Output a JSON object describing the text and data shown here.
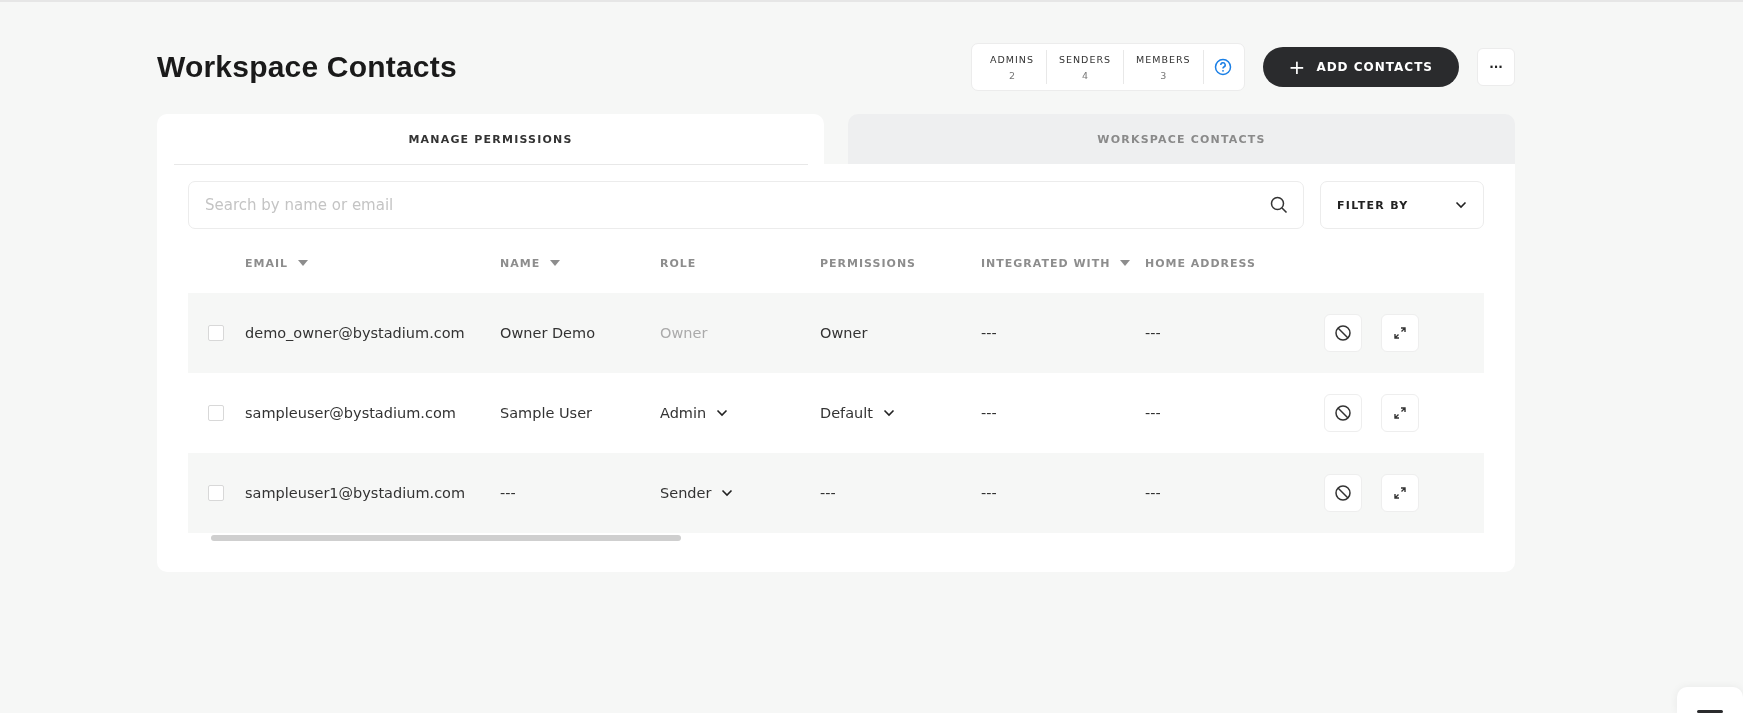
{
  "page_title": "Workspace Contacts",
  "stats": [
    {
      "label": "ADMINS",
      "count": "2"
    },
    {
      "label": "SENDERS",
      "count": "4"
    },
    {
      "label": "MEMBERS",
      "count": "3"
    }
  ],
  "add_button": {
    "icon": "+",
    "label": "ADD CONTACTS"
  },
  "more_button": "···",
  "tabs": [
    {
      "label": "MANAGE PERMISSIONS",
      "selected": true
    },
    {
      "label": "WORKSPACE CONTACTS",
      "selected": false
    }
  ],
  "search": {
    "placeholder": "Search by name or email"
  },
  "filter": {
    "label": "FILTER BY"
  },
  "table": {
    "columns": [
      {
        "label": "EMAIL",
        "sortable": true
      },
      {
        "label": "NAME",
        "sortable": true
      },
      {
        "label": "ROLE",
        "sortable": false
      },
      {
        "label": "PERMISSIONS",
        "sortable": false
      },
      {
        "label": "INTEGRATED WITH",
        "sortable": true
      },
      {
        "label": "HOME ADDRESS",
        "sortable": false
      }
    ],
    "rows": [
      {
        "checked": false,
        "email": "demo_owner@bystadium.com",
        "name": "Owner Demo",
        "role": {
          "text": "Owner",
          "editable": false
        },
        "permissions": {
          "text": "Owner",
          "editable": false
        },
        "integrated_with": "---",
        "home_address": "---"
      },
      {
        "checked": false,
        "email": "sampleuser@bystadium.com",
        "name": "Sample User",
        "role": {
          "text": "Admin",
          "editable": true
        },
        "permissions": {
          "text": "Default",
          "editable": true
        },
        "integrated_with": "---",
        "home_address": "---"
      },
      {
        "checked": false,
        "email": "sampleuser1@bystadium.com",
        "name": "---",
        "role": {
          "text": "Sender",
          "editable": true
        },
        "permissions": {
          "text": "---",
          "editable": false
        },
        "integrated_with": "---",
        "home_address": "---"
      }
    ]
  }
}
